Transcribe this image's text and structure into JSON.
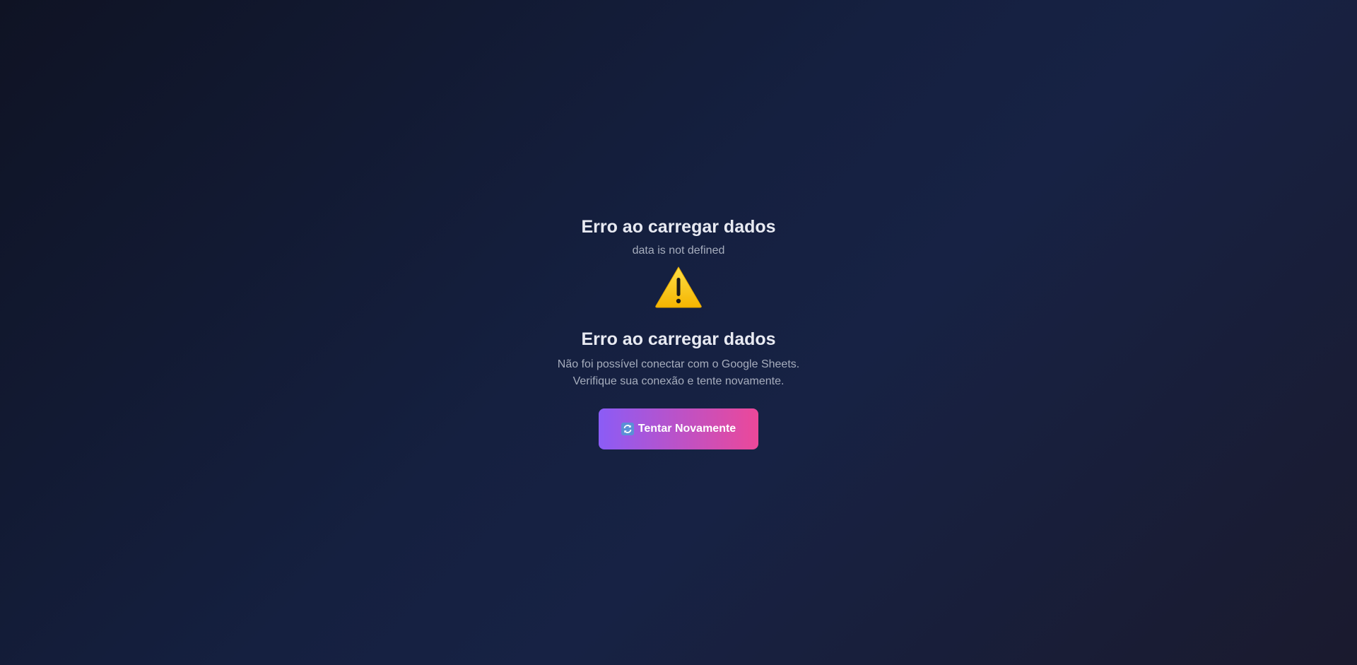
{
  "error_banner": {
    "title": "Erro ao carregar dados",
    "detail": "data is not defined"
  },
  "error_card": {
    "icon": "warning-icon",
    "title": "Erro ao carregar dados",
    "message_line1": "Não foi possível conectar com o Google Sheets.",
    "message_line2": "Verifique sua conexão e tente novamente.",
    "retry_button": {
      "icon": "refresh-icon",
      "label": "Tentar Novamente"
    }
  },
  "colors": {
    "accent_start": "#8b5cf6",
    "accent_end": "#ec4899",
    "warning": "#fbbf24"
  }
}
